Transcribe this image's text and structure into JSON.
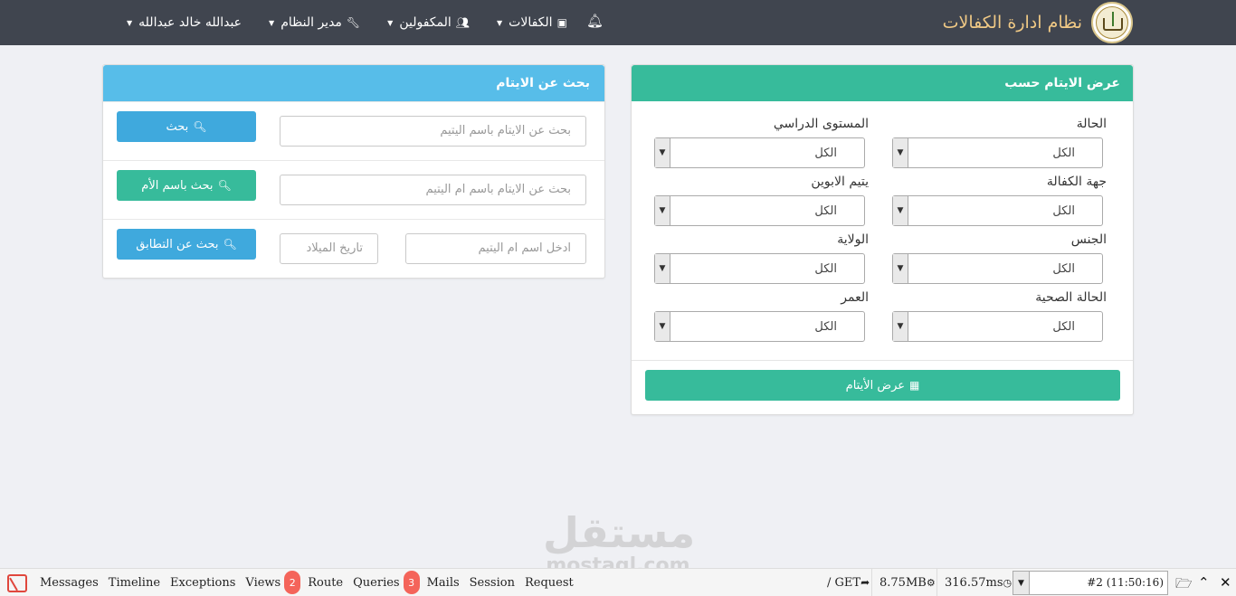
{
  "navbar": {
    "brand_title": "نظام ادارة الكفالات",
    "items": [
      {
        "label": "الكفالات",
        "icon": "money-icon"
      },
      {
        "label": "المكفولين",
        "icon": "users-icon"
      },
      {
        "label": "مدير النظام",
        "icon": "wrench-icon"
      },
      {
        "label": "عبدالله خالد عبدالله"
      }
    ],
    "caret": "▼"
  },
  "search_panel": {
    "title": "بحث عن الايتام",
    "name_placeholder": "بحث عن الايتام باسم اليتيم",
    "search_button": "بحث",
    "mother_placeholder": "بحث عن الايتام باسم ام اليتيم",
    "mother_button": "بحث باسم الأم",
    "mother_name_placeholder": "ادخل اسم ام اليتيم",
    "birthdate_placeholder": "تاريخ الميلاد",
    "match_button": "بحث عن التطابق"
  },
  "filter_panel": {
    "title": "عرض الايتام حسب",
    "fields": [
      {
        "label": "الحالة",
        "value": "الكل"
      },
      {
        "label": "المستوى الدراسي",
        "value": "الكل"
      },
      {
        "label": "جهة الكفالة",
        "value": "الكل"
      },
      {
        "label": "يتيم الابوين",
        "value": "الكل"
      },
      {
        "label": "الجنس",
        "value": "الكل"
      },
      {
        "label": "الولاية",
        "value": "الكل"
      },
      {
        "label": "الحالة الصحية",
        "value": "الكل"
      },
      {
        "label": "العمر",
        "value": "الكل"
      }
    ],
    "show_button": "عرض الأيتام"
  },
  "watermark": {
    "arabic": "مستقل",
    "latin": "mostaql.com"
  },
  "debugbar": {
    "tabs": [
      {
        "label": "Messages"
      },
      {
        "label": "Timeline"
      },
      {
        "label": "Exceptions"
      },
      {
        "label": "Views",
        "badge": "2"
      },
      {
        "label": "Route"
      },
      {
        "label": "Queries",
        "badge": "3"
      },
      {
        "label": "Mails"
      },
      {
        "label": "Session"
      },
      {
        "label": "Request"
      }
    ],
    "method": "GET",
    "path": "/",
    "memory": "8.75MB",
    "time": "316.57ms",
    "request_select": "#2 (11:50:16)"
  },
  "colors": {
    "navbar": "#40454f",
    "brand": "#f0c985",
    "search_header": "#57bde9",
    "filter_header": "#37bb9b",
    "button_blue": "#3fa9dd",
    "button_green": "#37bb9b"
  }
}
